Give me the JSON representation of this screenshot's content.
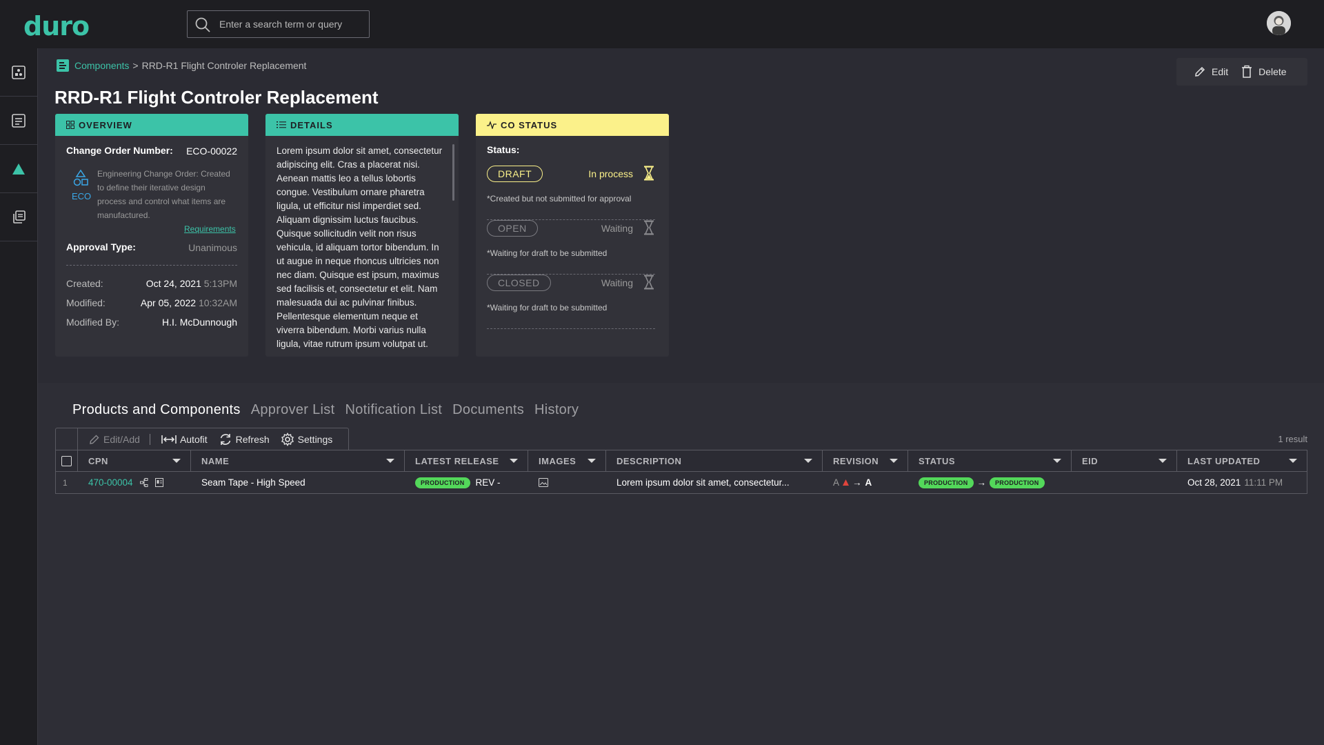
{
  "app": {
    "logo": "duro"
  },
  "search": {
    "placeholder": "Enter a search term or query"
  },
  "breadcrumb": {
    "root": "Components",
    "separator": ">",
    "current": "RRD-R1 Flight Controler Replacement"
  },
  "page": {
    "title": "RRD-R1 Flight Controler Replacement"
  },
  "actions": {
    "edit": "Edit",
    "delete": "Delete"
  },
  "overview": {
    "header": "OVERVIEW",
    "co_number_label": "Change Order Number:",
    "co_number": "ECO-00022",
    "eco_label": "ECO",
    "eco_description": "Engineering Change Order: Created to define their iterative design process and control what items are manufactured.",
    "requirements_link": "Requirements",
    "approval_type_label": "Approval Type:",
    "approval_type": "Unanimous",
    "created_label": "Created:",
    "created_date": "Oct 24, 2021",
    "created_time": "5:13PM",
    "modified_label": "Modified:",
    "modified_date": "Apr 05, 2022",
    "modified_time": "10:32AM",
    "modified_by_label": "Modified By:",
    "modified_by": "H.I. McDunnough"
  },
  "details": {
    "header": "DETAILS",
    "text": "Lorem ipsum dolor sit amet, consectetur adipiscing elit. Cras a placerat nisi. Aenean mattis leo a tellus lobortis congue. Vestibulum ornare pharetra ligula, ut efficitur nisl imperdiet sed. Aliquam dignissim luctus faucibus. Quisque sollicitudin velit non risus vehicula, id aliquam tortor bibendum. In ut augue in neque rhoncus ultricies non nec diam. Quisque est ipsum, maximus sed facilisis et, consectetur et elit. Nam malesuada dui ac pulvinar finibus. Pellentesque elementum neque et viverra bibendum. Morbi varius nulla ligula, vitae rutrum ipsum volutpat ut."
  },
  "co_status": {
    "header": "CO STATUS",
    "status_label": "Status:",
    "stages": [
      {
        "name": "DRAFT",
        "state": "In process",
        "note": "*Created but not submitted for approval"
      },
      {
        "name": "OPEN",
        "state": "Waiting",
        "note": "*Waiting for draft to be submitted"
      },
      {
        "name": "CLOSED",
        "state": "Waiting",
        "note": "*Waiting for draft to be submitted"
      }
    ]
  },
  "tabs": [
    "Products and Components",
    "Approver List",
    "Notification List",
    "Documents",
    "History"
  ],
  "toolbar": {
    "edit_add": "Edit/Add",
    "autofit": "Autofit",
    "refresh": "Refresh",
    "settings": "Settings"
  },
  "result_count": "1 result",
  "table": {
    "columns": [
      "CPN",
      "NAME",
      "LATEST RELEASE",
      "IMAGES",
      "DESCRIPTION",
      "REVISION",
      "STATUS",
      "EID",
      "LAST UPDATED"
    ],
    "rows": [
      {
        "index": "1",
        "cpn": "470-00004",
        "name": "Seam Tape - High Speed",
        "latest_release_badge": "PRODUCTION",
        "latest_release_rev": "REV -",
        "description": "Lorem ipsum dolor sit amet, consectetur...",
        "revision_from": "A",
        "revision_to": "A",
        "status_from": "PRODUCTION",
        "status_to": "PRODUCTION",
        "eid": "",
        "last_updated_date": "Oct 28, 2021",
        "last_updated_time": "11:11 PM"
      }
    ]
  },
  "colors": {
    "accent": "#3cc3a8",
    "warning": "#fbf18a",
    "success": "#53d85a",
    "alert": "#e0443c"
  }
}
